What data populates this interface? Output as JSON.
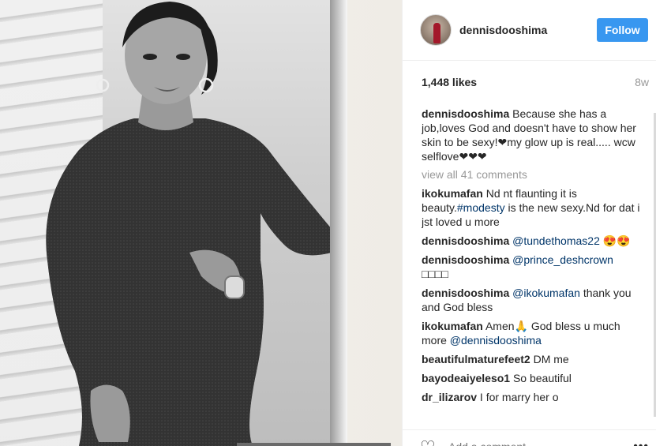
{
  "post": {
    "username": "dennisdooshima",
    "follow_label": "Follow",
    "likes": "1,448 likes",
    "age": "8w"
  },
  "comments": {
    "caption": {
      "user": "dennisdooshima",
      "text": "Because she has a job,loves God and doesn't have to show her skin to be sexy!❤my glow up is real..... wcw selflove❤❤❤"
    },
    "view_all": "view all 41 comments",
    "items": [
      {
        "user": "ikokumafan",
        "text": "Nd nt flaunting it is beauty.",
        "link": "#modesty",
        "text2": " is the new sexy.Nd for dat i jst loved u more"
      },
      {
        "user": "dennisdooshima",
        "link": "@tundethomas22",
        "text": " 😍😍"
      },
      {
        "user": "dennisdooshima",
        "link": "@prince_deshcrown",
        "text": " □□□□"
      },
      {
        "user": "dennisdooshima",
        "link": "@ikokumafan",
        "text": " thank you and God bless"
      },
      {
        "user": "ikokumafan",
        "text": "Amen🙏 God bless u much more ",
        "link": "@dennisdooshima"
      },
      {
        "user": "beautifulmaturefeet2",
        "text": "DM me"
      },
      {
        "user": "bayodeaiyeleso1",
        "text": "So beautiful"
      },
      {
        "user": "dr_ilizarov",
        "text": "I for marry her o"
      }
    ]
  },
  "add_comment": {
    "placeholder": "Add a comment...",
    "more": "•••"
  },
  "colors": {
    "follow_bg": "#3897f0",
    "link": "#003569",
    "muted": "#999999"
  }
}
